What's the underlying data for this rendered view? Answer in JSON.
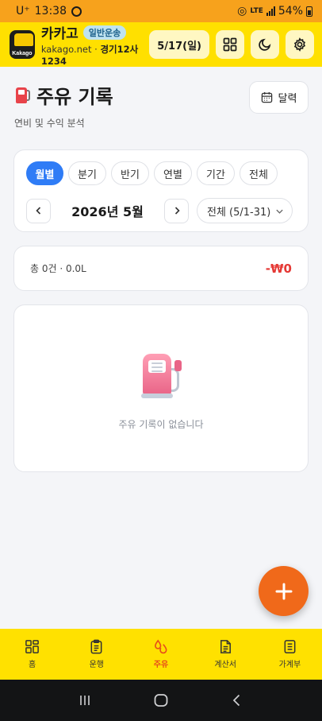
{
  "status_bar": {
    "carrier": "U⁺",
    "time": "13:38",
    "network": "LTE",
    "battery": "54%"
  },
  "header": {
    "logo_text": "Kakago",
    "app_name": "카카고",
    "badge": "일반운송",
    "domain": "kakago.net",
    "separator": "·",
    "plate": "경기12사1234",
    "date_button": "5/17(일)",
    "icons": [
      "grid-icon",
      "moon-icon",
      "gear-icon"
    ]
  },
  "page": {
    "title": "주유 기록",
    "subtitle": "연비 및 수익 분석",
    "calendar_button": "달력"
  },
  "filters": {
    "tabs": [
      {
        "label": "월별",
        "active": true
      },
      {
        "label": "분기",
        "active": false
      },
      {
        "label": "반기",
        "active": false
      },
      {
        "label": "연별",
        "active": false
      },
      {
        "label": "기간",
        "active": false
      },
      {
        "label": "전체",
        "active": false
      }
    ],
    "month_label": "2026년 5월",
    "range_value": "전체 (5/1-31)"
  },
  "summary": {
    "text": "총 0건 · 0.0L",
    "amount": "-₩0"
  },
  "empty": {
    "message": "주유 기록이 없습니다"
  },
  "bottom_nav": [
    {
      "label": "홈",
      "icon": "home-grid-icon",
      "active": false
    },
    {
      "label": "운행",
      "icon": "clipboard-icon",
      "active": false
    },
    {
      "label": "주유",
      "icon": "fuel-drop-icon",
      "active": true
    },
    {
      "label": "계산서",
      "icon": "document-icon",
      "active": false
    },
    {
      "label": "가계부",
      "icon": "ledger-icon",
      "active": false
    }
  ],
  "colors": {
    "accent_yellow": "#ffe000",
    "primary_blue": "#2f7cf6",
    "fab_orange": "#f0691a",
    "negative_red": "#e53935"
  }
}
